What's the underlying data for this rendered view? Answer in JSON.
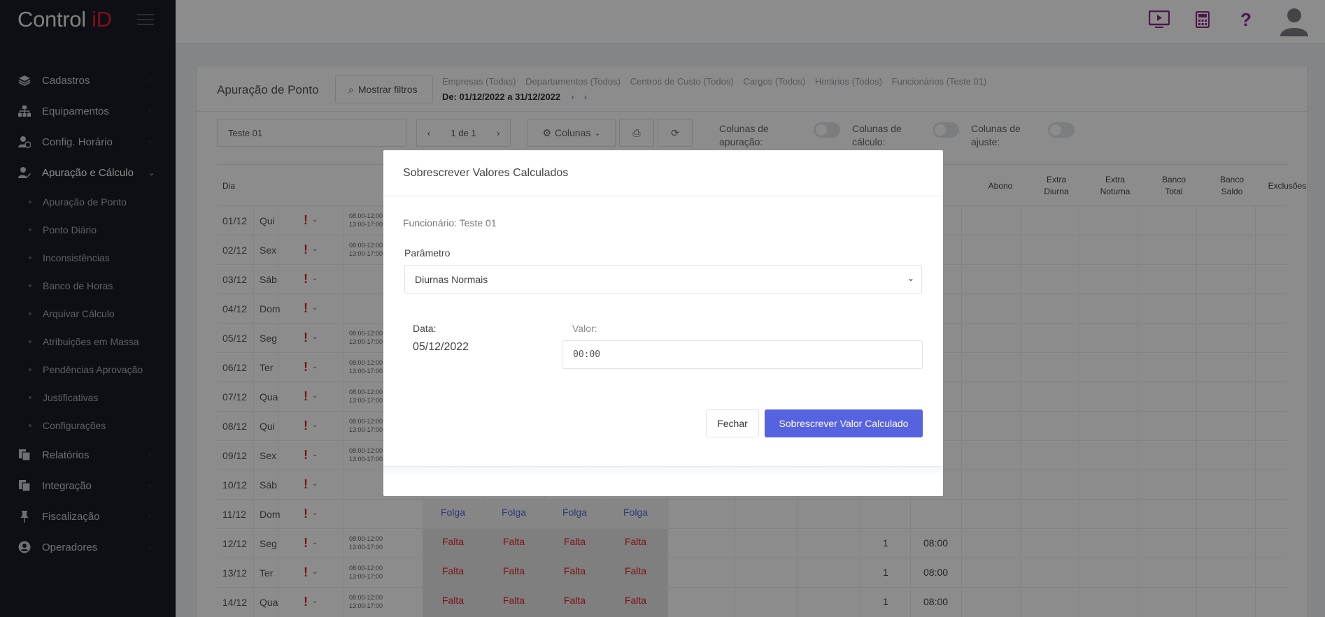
{
  "brand": {
    "text": "Control ",
    "accent": "iD"
  },
  "sidebar": {
    "items": [
      {
        "label": "Cadastros",
        "icon": "layers-icon"
      },
      {
        "label": "Equipamentos",
        "icon": "sitemap-icon"
      },
      {
        "label": "Config. Horário",
        "icon": "user-clock-icon"
      },
      {
        "label": "Apuração e Cálculo",
        "icon": "user-edit-icon",
        "expanded": true
      },
      {
        "label": "Relatórios",
        "icon": "files-icon"
      },
      {
        "label": "Integração",
        "icon": "files-icon"
      },
      {
        "label": "Fiscalização",
        "icon": "pin-icon"
      },
      {
        "label": "Operadores",
        "icon": "user-circle-icon"
      }
    ],
    "sub_items": [
      "Apuração de Ponto",
      "Ponto Diário",
      "Inconsistências",
      "Banco de Horas",
      "Arquivar Cálculo",
      "Atribuições em Massa",
      "Pendências Aprovação",
      "Justificativas",
      "Configurações"
    ]
  },
  "page": {
    "title": "Apuração de Ponto",
    "show_filters": "Mostrar filtros",
    "filters": [
      "Empresas (Todas)",
      "Departamentos (Todos)",
      "Centros de Custo (Todos)",
      "Cargos (Todos)",
      "Horários (Todos)",
      "Funcionários (Teste 01)"
    ],
    "period": "De: 01/12/2022 a 31/12/2022",
    "employee_select": "Teste 01",
    "pager": "1 de 1",
    "columns_button": "Colunas",
    "toggles": [
      {
        "line1": "Colunas de",
        "line2": "apuração:"
      },
      {
        "line1": "Colunas de",
        "line2": "cálculo:"
      },
      {
        "line1": "Colunas de",
        "line2": "ajuste:"
      }
    ]
  },
  "table": {
    "headers": {
      "dia": "Dia",
      "abono": "Abono",
      "extra_diurna_1": "Extra",
      "extra_diurna_2": "Diurna",
      "extra_noturna_1": "Extra",
      "extra_noturna_2": "Noturna",
      "banco_total_1": "Banco",
      "banco_total_2": "Total",
      "banco_saldo_1": "Banco",
      "banco_saldo_2": "Saldo",
      "exclusoes": "Exclusões"
    },
    "schedule_line1": "08:00-12:00",
    "schedule_line2": "13:00-17:00",
    "rows": [
      {
        "date": "01/12",
        "weekday": "Qui"
      },
      {
        "date": "02/12",
        "weekday": "Sex"
      },
      {
        "date": "03/12",
        "weekday": "Sáb"
      },
      {
        "date": "04/12",
        "weekday": "Dom"
      },
      {
        "date": "05/12",
        "weekday": "Seg"
      },
      {
        "date": "06/12",
        "weekday": "Ter"
      },
      {
        "date": "07/12",
        "weekday": "Qua"
      },
      {
        "date": "08/12",
        "weekday": "Qui"
      },
      {
        "date": "09/12",
        "weekday": "Sex"
      },
      {
        "date": "10/12",
        "weekday": "Sáb"
      },
      {
        "date": "11/12",
        "weekday": "Dom",
        "mark": "Folga"
      },
      {
        "date": "12/12",
        "weekday": "Seg",
        "mark": "Falta",
        "count": "1",
        "hours": "08:00"
      },
      {
        "date": "13/12",
        "weekday": "Ter",
        "mark": "Falta",
        "count": "1",
        "hours": "08:00"
      },
      {
        "date": "14/12",
        "weekday": "Qua",
        "mark": "Falta",
        "count": "1",
        "hours": "08:00"
      }
    ]
  },
  "modal": {
    "title": "Sobrescrever Valores Calculados",
    "employee": "Funcionário: Teste 01",
    "param_label": "Parâmetro",
    "param_value": "Diurnas Normais",
    "date_label": "Data:",
    "date_value": "05/12/2022",
    "value_label": "Valor:",
    "value": "00:00",
    "close_button": "Fechar",
    "submit_button": "Sobrescrever Valor Calculado"
  },
  "colors": {
    "sidebar_bg": "#1a1d26",
    "brand_accent": "#e3202b",
    "primary": "#5663e0",
    "warning": "#e3202b",
    "top_icons": "#8a2a8a"
  }
}
